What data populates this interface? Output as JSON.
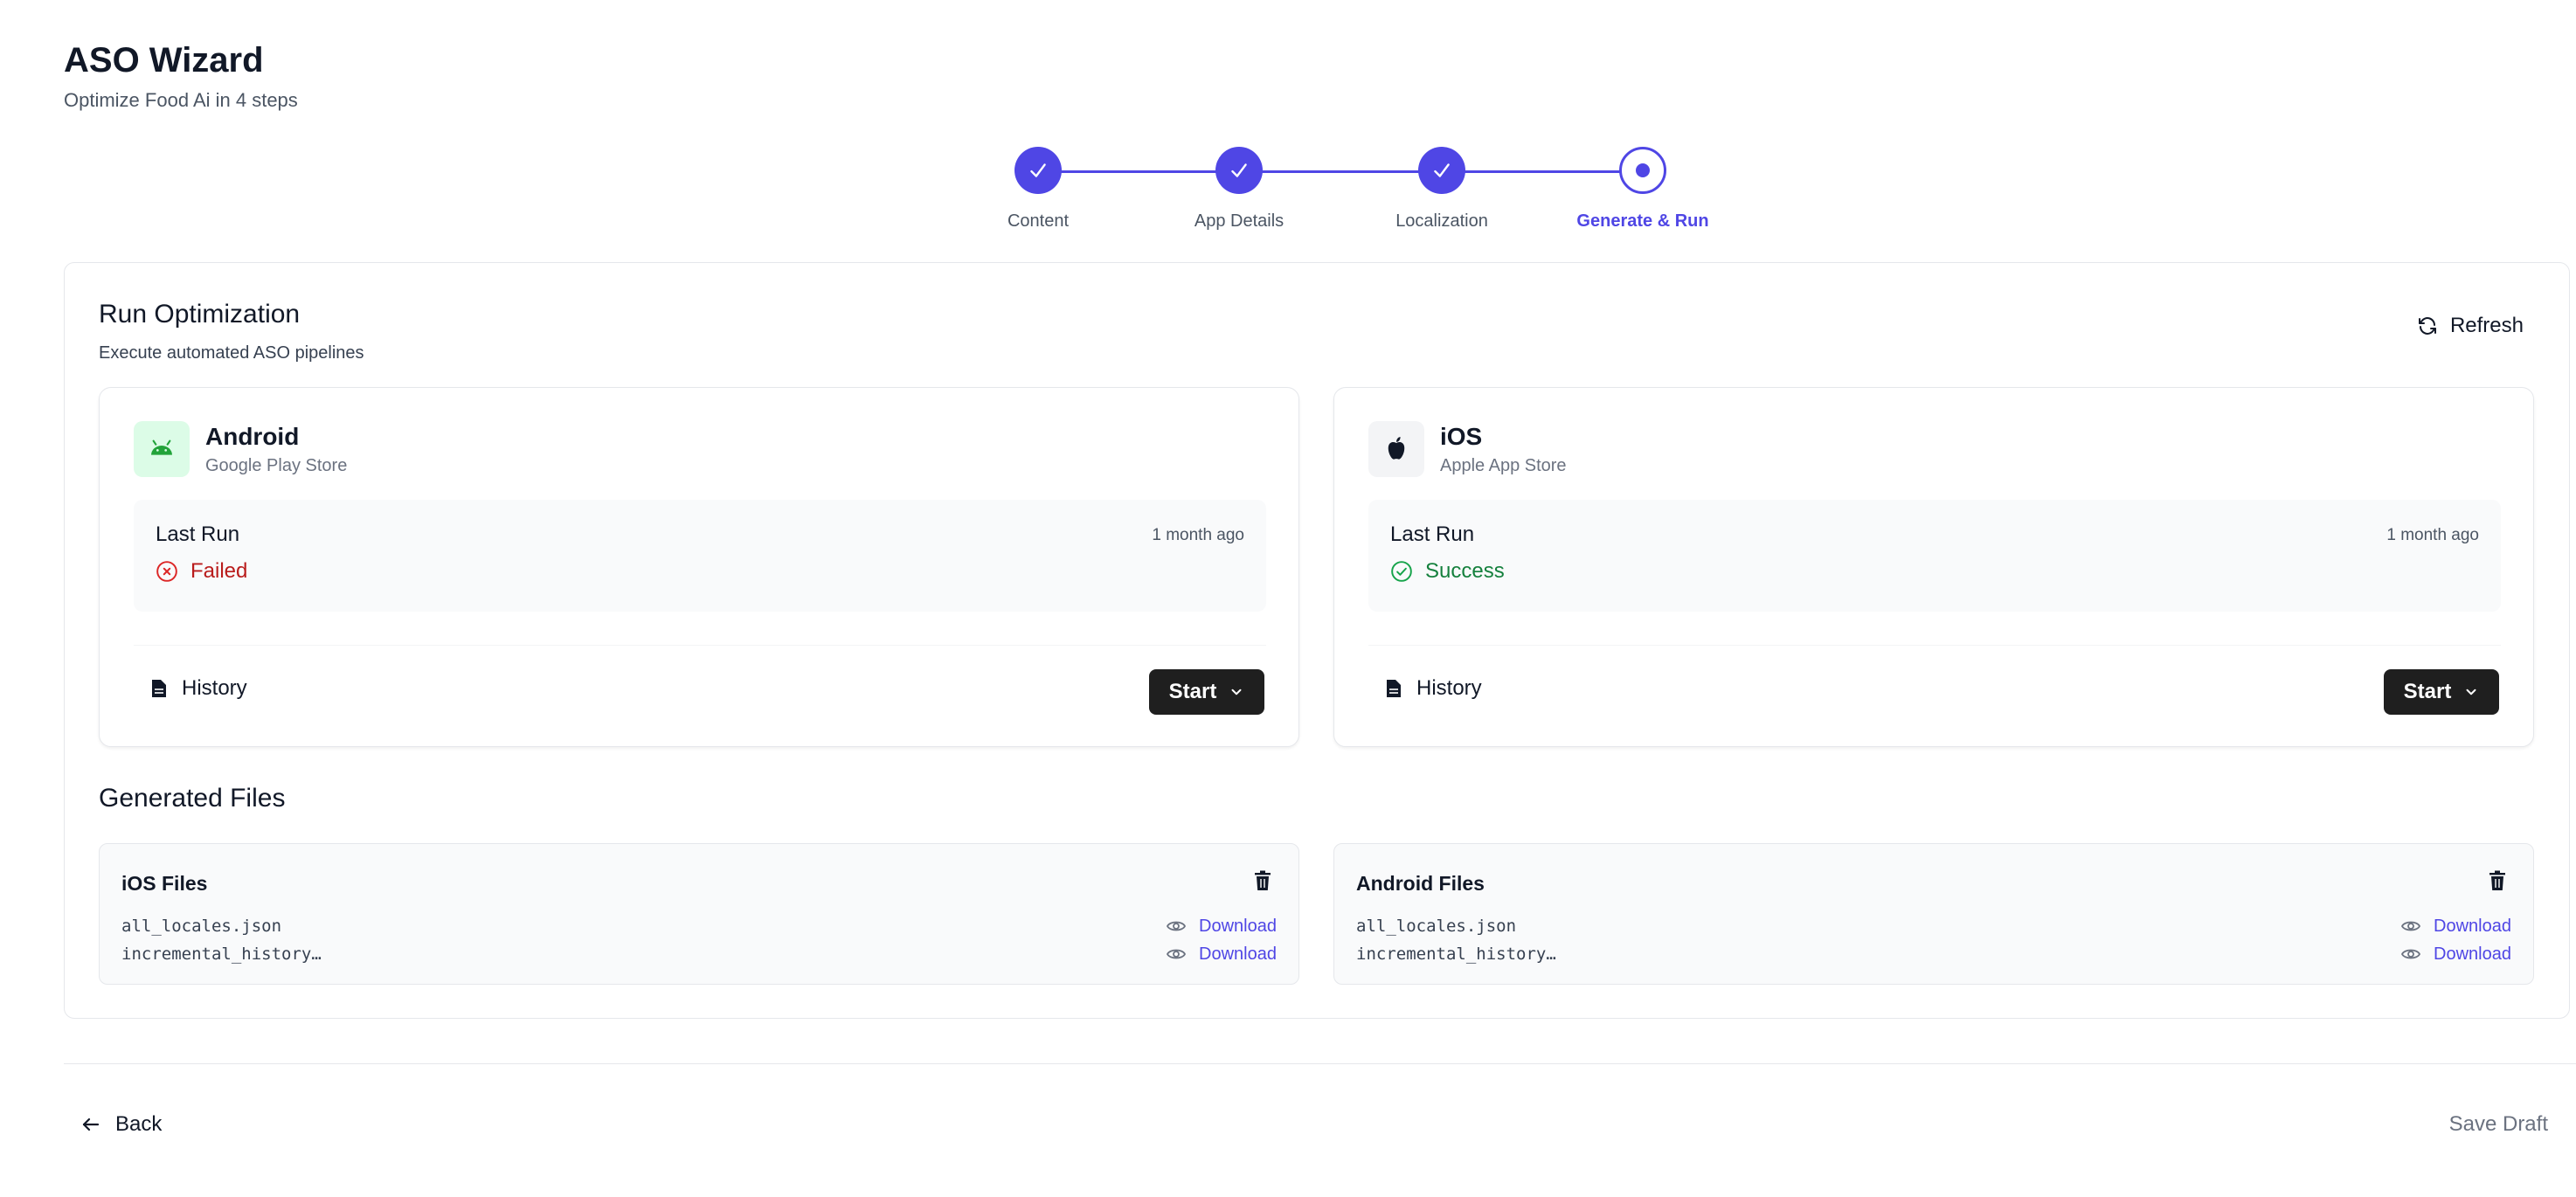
{
  "header": {
    "title": "ASO Wizard",
    "subtitle": "Optimize Food Ai in 4 steps"
  },
  "stepper": {
    "steps": [
      {
        "label": "Content",
        "state": "complete"
      },
      {
        "label": "App Details",
        "state": "complete"
      },
      {
        "label": "Localization",
        "state": "complete"
      },
      {
        "label": "Generate & Run",
        "state": "current"
      }
    ],
    "accent_color": "#4f46e5"
  },
  "run": {
    "title": "Run Optimization",
    "subtitle": "Execute automated ASO pipelines",
    "refresh_label": "Refresh"
  },
  "platforms": {
    "android": {
      "name": "Android",
      "store": "Google Play Store",
      "icon": "android-icon",
      "last_run_label": "Last Run",
      "last_run_time": "1 month ago",
      "status": "Failed",
      "status_color": "#b91c1c",
      "history_label": "History",
      "start_label": "Start"
    },
    "ios": {
      "name": "iOS",
      "store": "Apple App Store",
      "icon": "apple-icon",
      "last_run_label": "Last Run",
      "last_run_time": "1 month ago",
      "status": "Success",
      "status_color": "#15803d",
      "history_label": "History",
      "start_label": "Start"
    }
  },
  "generated": {
    "title": "Generated Files",
    "ios": {
      "title": "iOS Files",
      "files": [
        {
          "name": "all_locales.json",
          "action": "Download"
        },
        {
          "name": "incremental_history…",
          "action": "Download"
        }
      ]
    },
    "android": {
      "title": "Android Files",
      "files": [
        {
          "name": "all_locales.json",
          "action": "Download"
        },
        {
          "name": "incremental_history…",
          "action": "Download"
        }
      ]
    }
  },
  "footer": {
    "back_label": "Back",
    "save_draft_label": "Save Draft"
  }
}
